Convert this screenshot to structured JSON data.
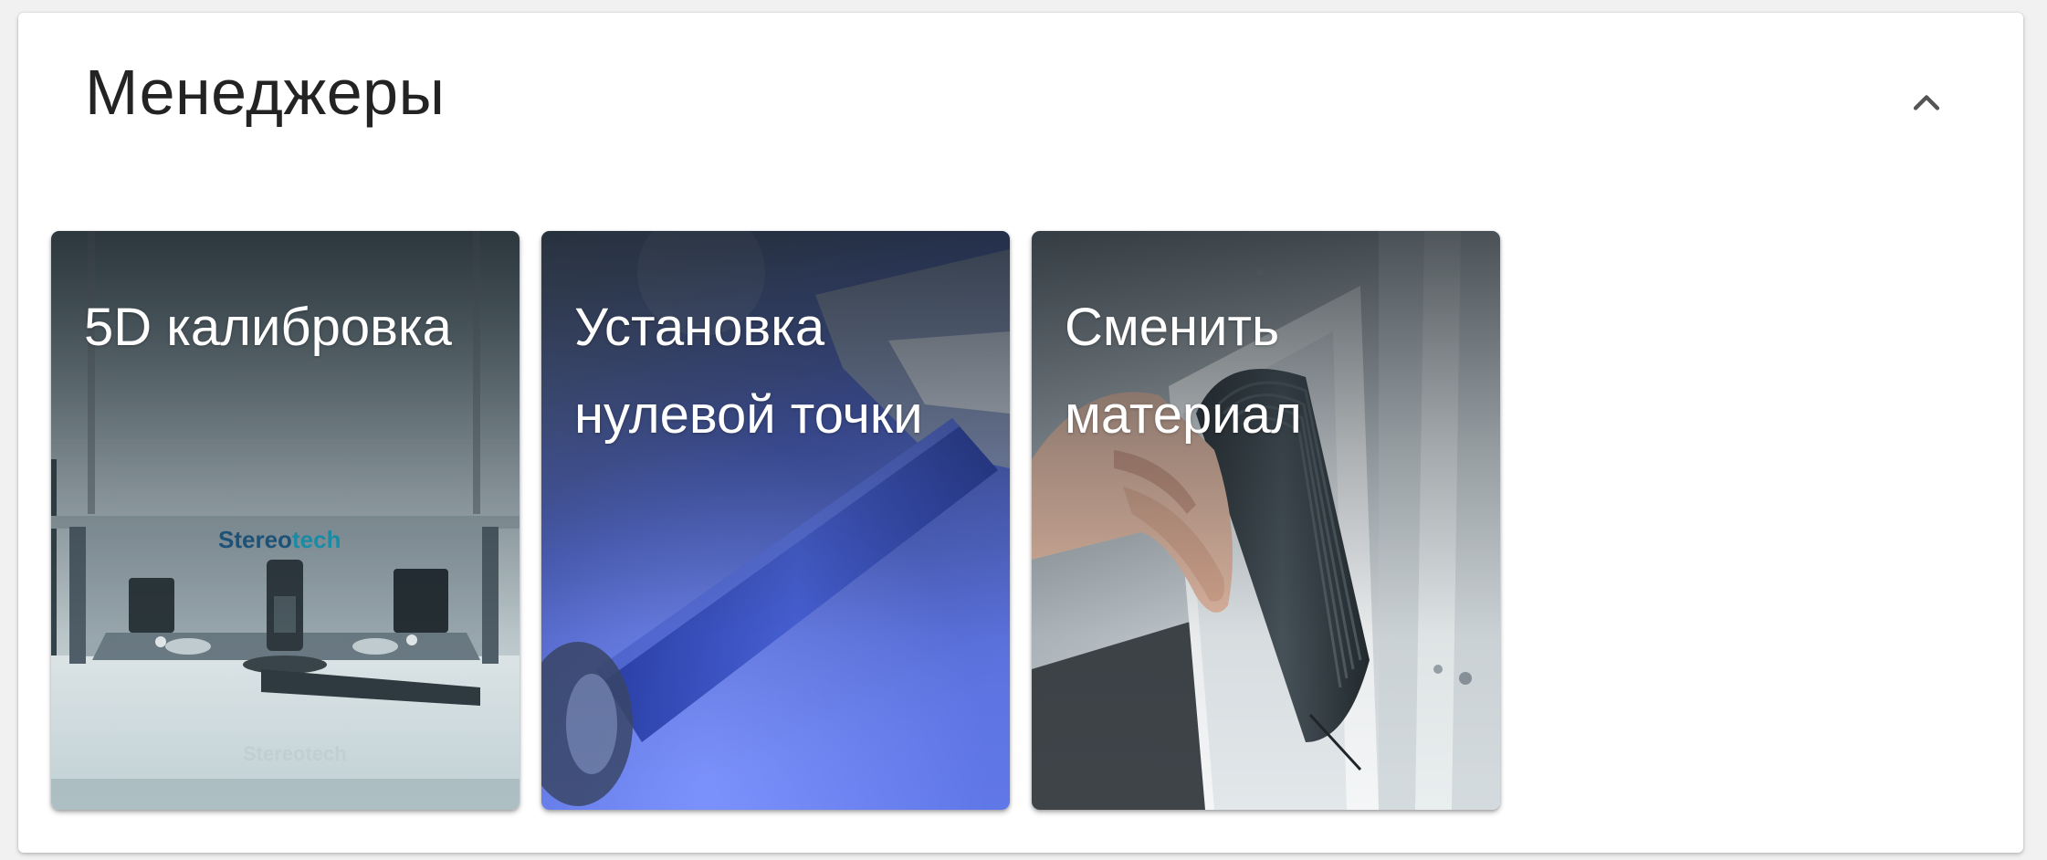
{
  "panel": {
    "title": "Менеджеры",
    "collapse_icon": "chevron-up-icon"
  },
  "cards": [
    {
      "title": "5D калибровка",
      "image_icon": "printer-mechanism-photo",
      "brand_text": "Stereotech"
    },
    {
      "title": "Установка нулевой точки",
      "image_icon": "nozzle-closeup-photo"
    },
    {
      "title": "Сменить материал",
      "image_icon": "filament-spool-photo"
    }
  ],
  "colors": {
    "panel_bg": "#ffffff",
    "page_bg": "#f1f1f2",
    "title_text": "#232323",
    "card_text": "#ffffff",
    "brand_blue": "#1f5f8b",
    "brand_cyan": "#1aa6c4",
    "nozzle_blue": "#3d55c9"
  }
}
